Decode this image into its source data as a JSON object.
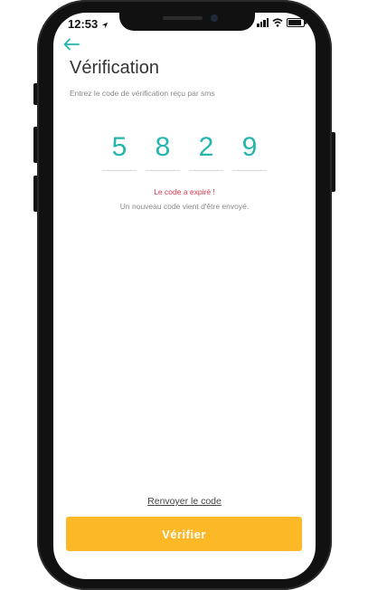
{
  "status_bar": {
    "time": "12:53"
  },
  "header": {
    "title": "Vérification",
    "subtitle": "Entrez le code de vérification reçu par sms"
  },
  "code": {
    "digits": [
      "5",
      "8",
      "2",
      "9"
    ]
  },
  "messages": {
    "error": "Le code a expiré !",
    "info": "Un nouveau code vient d'être envoyé."
  },
  "actions": {
    "resend_label": "Renvoyer le code",
    "verify_label": "Vérifier"
  },
  "colors": {
    "accent": "#24b5ad",
    "button": "#fdb827",
    "error": "#e2344a"
  },
  "icons": {
    "back": "arrow-left-icon",
    "location": "location-arrow-icon",
    "signal": "signal-icon",
    "wifi": "wifi-icon",
    "battery": "battery-icon"
  }
}
